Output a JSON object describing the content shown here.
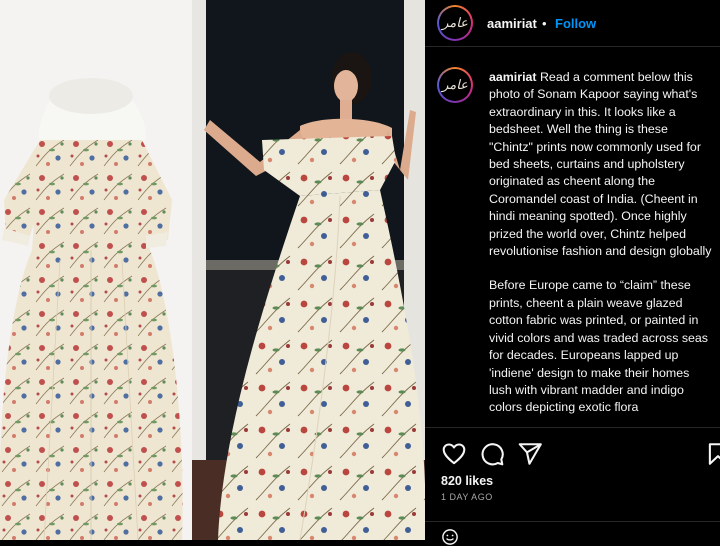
{
  "post": {
    "username": "aamiriat",
    "separator": "•",
    "follow_label": "Follow",
    "avatar_text": "عامر",
    "caption_user": "aamiriat",
    "caption_p1": "Read a comment below this photo of Sonam Kapoor saying what's extraordinary in this. It looks like a bedsheet. Well the thing is these \"Chintz\" prints now commonly used for bed sheets, curtains and upholstery originated as cheent along the Coromandel coast of India. (Cheent in hindi meaning spotted). Once highly prized the world over, Chintz helped revolutionise fashion and design globally",
    "caption_p2": "Before Europe came to “claim” these prints, cheent a plain weave glazed cotton fabric was printed, or painted in vivid colors and was traded across seas for decades. Europeans lapped up 'indiene' design to make their homes lush with vibrant madder and indigo colors depicting exotic flora",
    "likes": "820 likes",
    "posted": "1 DAY AGO"
  },
  "icons": [
    "heart-icon",
    "comment-icon",
    "share-icon",
    "bookmark-icon",
    "emoji-icon"
  ],
  "colors": {
    "follow": "#0095f6",
    "background": "#000000",
    "muted": "#a8a8a8"
  }
}
